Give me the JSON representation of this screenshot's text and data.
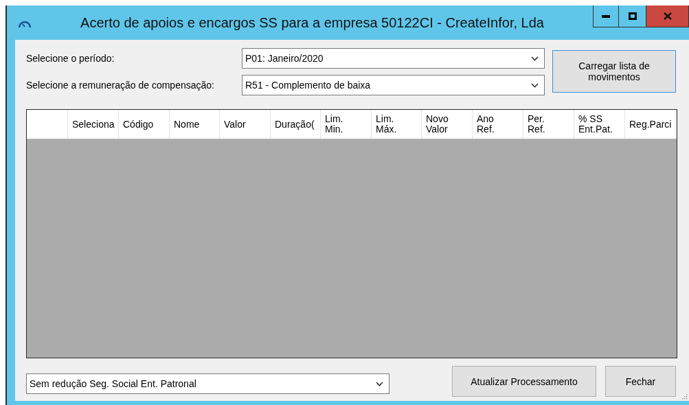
{
  "window": {
    "title": "Acerto de apoios e encargos SS para a empresa 50122CI - CreateInfor, Lda"
  },
  "period": {
    "label": "Selecione o período:",
    "value": "P01: Janeiro/2020"
  },
  "compensation": {
    "label": "Selecione a remuneração de compensação:",
    "value": "R51 - Complemento de baixa"
  },
  "load_button": "Carregar lista de\nmovimentos",
  "table": {
    "columns": [
      "Seleciona",
      "Código",
      "Nome",
      "Valor",
      "Duração(",
      "Lim.\nMin.",
      "Lim.\nMáx.",
      "Novo\nValor",
      "Ano\nRef.",
      "Per.\nRef.",
      "% SS\nEnt.Pat.",
      "Reg.Parci"
    ]
  },
  "reduction": {
    "value": "Sem redução Seg. Social Ent. Patronal"
  },
  "buttons": [
    "Atualizar Processamento",
    "Fechar"
  ]
}
